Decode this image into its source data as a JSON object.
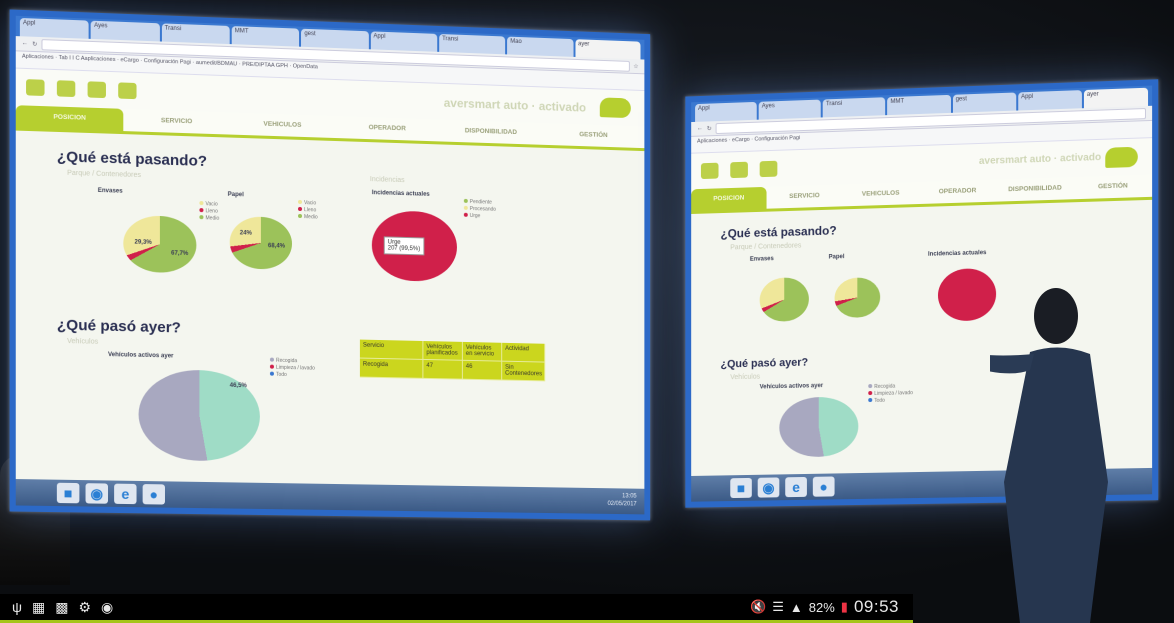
{
  "browser": {
    "tabs_left": [
      "Appl",
      "Ayes",
      "Transi",
      "MMT",
      "gest",
      "Appl",
      "Transi",
      "Mao",
      "",
      "ayer"
    ],
    "tabs_right": [
      "Appl",
      "Ayes",
      "Transi",
      "MMT",
      "gest",
      "Appl",
      "Transi",
      "Mao",
      "",
      "ayer"
    ],
    "bookmarks": [
      "Aplicaciones",
      "Tab I I C Aaplicaciones",
      "eCargo",
      "Configuración Pagi",
      "aumedit/BDMAU",
      "PRE/DIPTAA GPH",
      "OpenData"
    ]
  },
  "app": {
    "brand": "aversmart auto · activado",
    "nav": [
      "POSICION",
      "SERVICIO",
      "VEHICULOS",
      "OPERADOR",
      "DISPONIBILIDAD",
      "GESTIÓN"
    ],
    "heading_now": "¿Qué está pasando?",
    "heading_yesterday": "¿Qué pasó ayer?",
    "sub_now": "Parque / Contenedores",
    "sub_incidents": "Incidencias",
    "sub_vehicles": "Vehículos",
    "pie1_title": "Envases",
    "pie2_title": "Papel",
    "pie3_title": "Incidencias actuales",
    "vehicles_title": "Vehículos activos ayer",
    "pie1_label_a": "29,3%",
    "pie1_label_b": "67,7%",
    "pie2_label_a": "24%",
    "pie2_label_b": "68,4%",
    "incident_callout": "Urge\n207 (99,5%)",
    "vehicles_label": "46,5%",
    "legend_fill": [
      "Vacio",
      "Lleno",
      "Medio"
    ],
    "legend_incidents": [
      "Pendiente",
      "Procesando",
      "Urge"
    ],
    "legend_vehicles": [
      "Recogida",
      "Limpieza / lavado",
      "Todo"
    ],
    "table_headers": [
      "Servicio",
      "Vehículos planificados",
      "Vehículos en servicio",
      "Actividad"
    ],
    "table_row": [
      "Recogida",
      "47",
      "46",
      "Sin Contenedores"
    ],
    "colors": {
      "brand_green": "#b6cf2f",
      "pie_green": "#9cc25a",
      "pie_cream": "#efe79a",
      "incident_red": "#d0204a",
      "vehicles_mint": "#9fdcc6",
      "vehicles_grey": "#a8a8c0"
    }
  },
  "taskbar": {
    "icons": [
      "start-orb",
      "explorer-icon",
      "chrome-icon",
      "ie-icon",
      "paint-icon"
    ],
    "time": "13:05",
    "date": "02/05/2017"
  },
  "phone_status": {
    "left_icons": [
      "usb-icon",
      "document-icon",
      "gallery-icon",
      "settings-icon",
      "camera-icon"
    ],
    "battery": "82%",
    "time": "09:53"
  }
}
